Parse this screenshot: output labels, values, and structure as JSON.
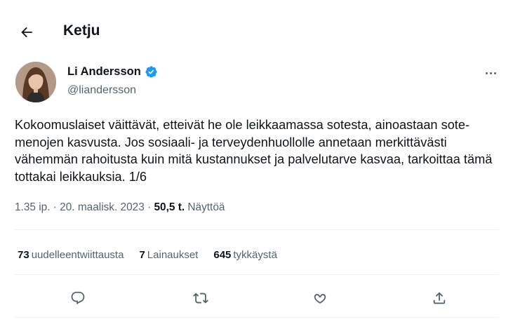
{
  "header": {
    "title": "Ketju",
    "back_icon": "arrow-left-icon"
  },
  "author": {
    "name": "Li Andersson",
    "handle": "@liandersson",
    "verified": true,
    "verified_color": "#1d9bf0"
  },
  "tweet": {
    "text": "Kokoomuslaiset väittävät, etteivät he ole leikkaamassa sotesta, ainoastaan sote-menojen kasvusta. Jos sosiaali- ja terveydenhuollolle annetaan merkittävästi vähemmän rahoitusta kuin mitä kustannukset ja palvelutarve kasvaa, tarkoittaa tämä tottakai leikkauksia. 1/6",
    "timestamp": "1.35 ip. · 20. maalisk. 2023",
    "separator": " · ",
    "views_count": "50,5 t.",
    "views_label": "Näyttöä"
  },
  "stats": {
    "retweets_count": "73",
    "retweets_label": "uudelleentwiittausta",
    "quotes_count": "7",
    "quotes_label": "Lainaukset",
    "likes_count": "645",
    "likes_label": "tykkäystä"
  },
  "actions": [
    "reply-icon",
    "retweet-icon",
    "like-icon",
    "share-icon"
  ],
  "colors": {
    "text": "#0f1419",
    "secondary": "#536471",
    "divider": "#eff3f4",
    "accent": "#1d9bf0"
  }
}
